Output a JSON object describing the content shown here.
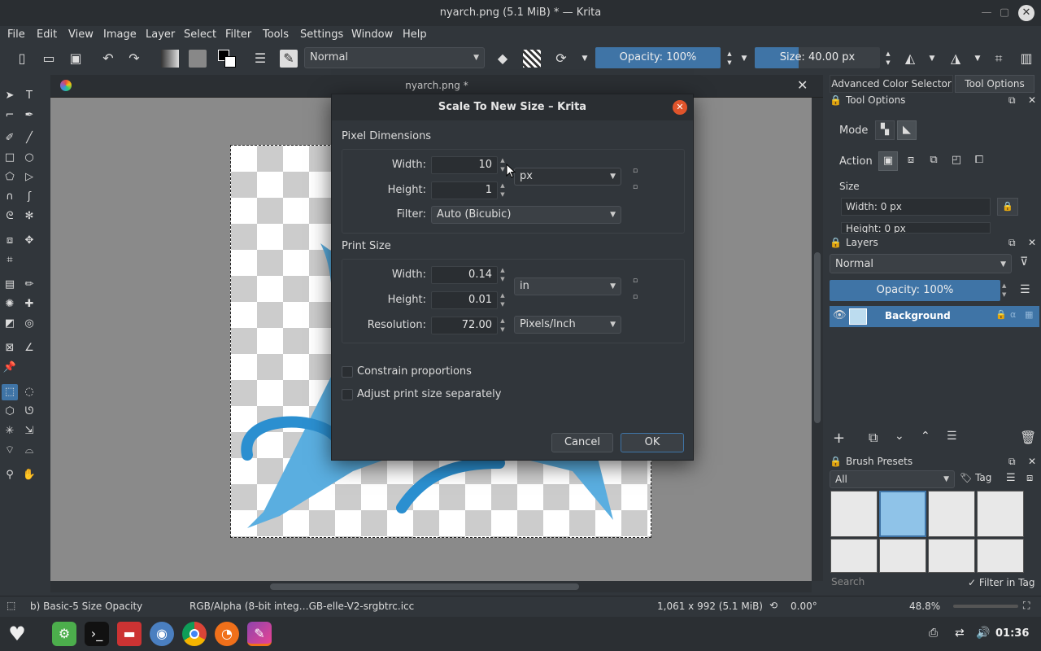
{
  "window": {
    "title": "nyarch.png (5.1 MiB)  * — Krita"
  },
  "menu": [
    "File",
    "Edit",
    "View",
    "Image",
    "Layer",
    "Select",
    "Filter",
    "Tools",
    "Settings",
    "Window",
    "Help"
  ],
  "toolbar": {
    "blend_mode": "Normal",
    "opacity_label": "Opacity: 100%",
    "size_label": "Size: 40.00 px"
  },
  "document": {
    "tab_title": "nyarch.png *"
  },
  "dialog": {
    "title": "Scale To New Size – Krita",
    "pixel_dimensions": {
      "section_label": "Pixel Dimensions",
      "width_label": "Width:",
      "width_value": "10",
      "height_label": "Height:",
      "height_value": "1",
      "unit": "px",
      "filter_label": "Filter:",
      "filter_value": "Auto (Bicubic)"
    },
    "print_size": {
      "section_label": "Print Size",
      "width_label": "Width:",
      "width_value": "0.14",
      "height_label": "Height:",
      "height_value": "0.01",
      "unit": "in",
      "resolution_label": "Resolution:",
      "resolution_value": "72.00",
      "resolution_unit": "Pixels/Inch"
    },
    "constrain_label": "Constrain proportions",
    "adjust_label": "Adjust print size separately",
    "cancel_label": "Cancel",
    "ok_label": "OK"
  },
  "dock": {
    "tabs": [
      "Advanced Color Selector",
      "Tool Options"
    ],
    "tool_options": {
      "title": "Tool Options",
      "mode_label": "Mode",
      "action_label": "Action",
      "size_label": "Size",
      "width_value": "Width: 0 px",
      "height_value": "Height: 0 px"
    },
    "layers": {
      "title": "Layers",
      "blend_mode": "Normal",
      "opacity_label": "Opacity:  100%",
      "layer_name": "Background"
    },
    "brush_presets": {
      "title": "Brush Presets",
      "filter_value": "All",
      "tag_label": "Tag",
      "search_placeholder": "Search",
      "filter_in_tag_label": "Filter in Tag"
    }
  },
  "status": {
    "brush": "b) Basic-5 Size Opacity",
    "color_profile": "RGB/Alpha (8-bit integ…GB-elle-V2-srgbtrc.icc",
    "dimensions": "1,061 x 992 (5.1 MiB)",
    "rotation": "0.00°",
    "zoom": "48.8%"
  },
  "taskbar": {
    "clock": "01:36"
  }
}
